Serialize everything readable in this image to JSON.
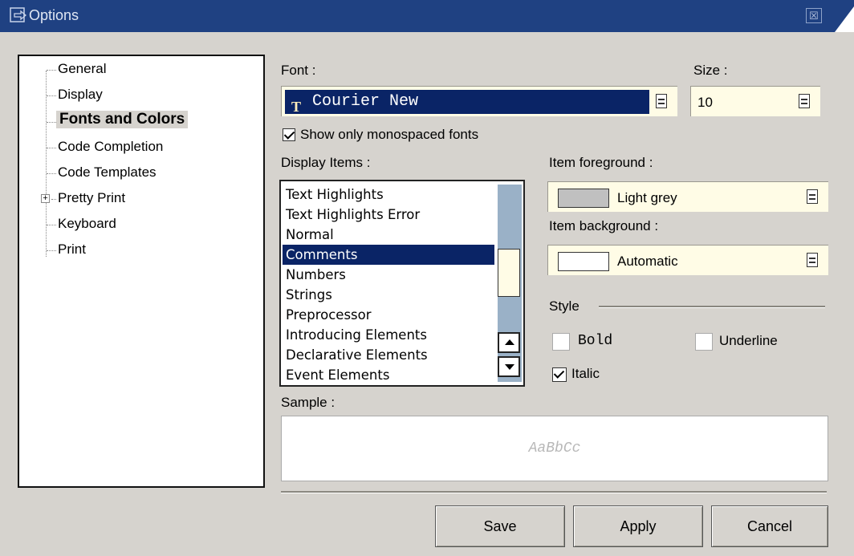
{
  "window": {
    "title": "Options",
    "close_glyph": "☒"
  },
  "tree": {
    "items": [
      {
        "label": "General"
      },
      {
        "label": "Display"
      },
      {
        "label": "Fonts and Colors"
      },
      {
        "label": "Code Completion"
      },
      {
        "label": "Code Templates"
      },
      {
        "label": "Pretty Print"
      },
      {
        "label": "Keyboard"
      },
      {
        "label": "Print"
      }
    ],
    "selected": "Fonts and Colors",
    "expander": "+"
  },
  "font": {
    "label": "Font :",
    "value": "Courier New",
    "icon": "truetype-icon"
  },
  "size": {
    "label": "Size :",
    "value": "10"
  },
  "monospace_checkbox": {
    "label": "Show only monospaced fonts",
    "checked": true
  },
  "display_items": {
    "label": "Display Items :",
    "items": [
      "Text Highlights",
      "Text Highlights Error",
      "Normal",
      "Comments",
      "Numbers",
      "Strings",
      "Preprocessor",
      "Introducing Elements",
      "Declarative Elements",
      "Event Elements"
    ],
    "selected": "Comments"
  },
  "foreground": {
    "label": "Item foreground :",
    "value": "Light grey",
    "swatch_color": "#c0c0c0"
  },
  "background": {
    "label": "Item background :",
    "value": "Automatic",
    "swatch_color": "#ffffff"
  },
  "style": {
    "label": "Style",
    "bold": {
      "label": "Bold",
      "checked": false
    },
    "underline": {
      "label": "Underline",
      "checked": false
    },
    "italic": {
      "label": "Italic",
      "checked": true
    }
  },
  "sample": {
    "label": "Sample :",
    "text": "AaBbCc"
  },
  "buttons": {
    "save": "Save",
    "apply": "Apply",
    "cancel": "Cancel"
  },
  "colors": {
    "titlebar": "#1f4182",
    "selection": "#0a2466",
    "combo_bg": "#fffce6",
    "dialog_bg": "#d6d3ce"
  }
}
